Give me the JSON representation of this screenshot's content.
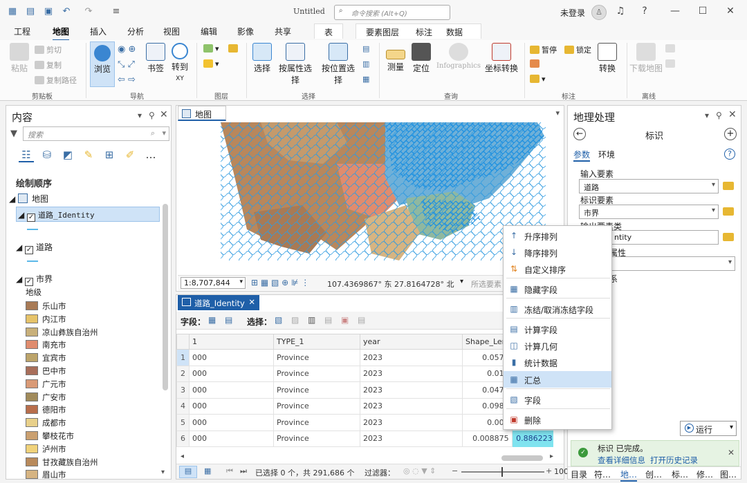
{
  "window": {
    "title": "Untitled",
    "search_placeholder": "命令搜索 (Alt+Q)",
    "login": "未登录",
    "help": "?"
  },
  "tabs": [
    "工程",
    "地图",
    "插入",
    "分析",
    "视图",
    "编辑",
    "影像",
    "共享"
  ],
  "active_tab": "地图",
  "context_tabs": [
    "表",
    "要素图层",
    "标注",
    "数据"
  ],
  "ribbon": {
    "clipboard": {
      "paste": "粘贴",
      "cut": "剪切",
      "copy": "复制",
      "copy_path": "复制路径",
      "label": "剪贴板"
    },
    "navigate": {
      "explore": "浏览",
      "bookmarks": "书签",
      "goto": "转到",
      "goto_sub": "XY",
      "label": "导航"
    },
    "layer": {
      "label": "图层"
    },
    "selection": {
      "select": "选择",
      "by_attr": "按属性选择",
      "by_loc": "按位置选择",
      "label": "选择"
    },
    "inquiry": {
      "measure": "测量",
      "locate": "定位",
      "infographics": "Infographics",
      "convert_coords": "坐标转换",
      "label": "查询"
    },
    "labeling": {
      "pause": "暂停",
      "lock": "锁定",
      "convert": "转换",
      "label": "标注"
    },
    "offline": {
      "download": "下载地图",
      "label": "离线"
    }
  },
  "contents": {
    "title": "内容",
    "search_placeholder": "搜索",
    "drawing_order": "绘制顺序",
    "map_node": "地图",
    "layers": [
      {
        "name": "道路_Identity",
        "checked": true,
        "selected": true
      },
      {
        "name": "道路",
        "checked": true
      },
      {
        "name": "市界",
        "checked": true
      }
    ],
    "legend_field": "地级",
    "legend": [
      {
        "name": "乐山市",
        "color": "#a87a55"
      },
      {
        "name": "内江市",
        "color": "#e6c36a"
      },
      {
        "name": "凉山彝族自治州",
        "color": "#c8b07a"
      },
      {
        "name": "南充市",
        "color": "#e08c6e"
      },
      {
        "name": "宜宾市",
        "color": "#bca46a"
      },
      {
        "name": "巴中市",
        "color": "#a86e5a"
      },
      {
        "name": "广元市",
        "color": "#d99a76"
      },
      {
        "name": "广安市",
        "color": "#a08a5a"
      },
      {
        "name": "德阳市",
        "color": "#b86e4c"
      },
      {
        "name": "成都市",
        "color": "#e8d08a"
      },
      {
        "name": "攀枝花市",
        "color": "#caa070"
      },
      {
        "name": "泸州市",
        "color": "#f0d27a"
      },
      {
        "name": "甘孜藏族自治州",
        "color": "#b88a5c"
      },
      {
        "name": "眉山市",
        "color": "#d6b482"
      }
    ]
  },
  "map": {
    "tab": "地图",
    "scale": "1:8,707,844",
    "coords": "107.4369867° 东  27.8164728° 北",
    "selected_features": "所选要素"
  },
  "attribute_table": {
    "tab": "道路_Identity",
    "field_label": "字段：",
    "select_label": "选择：",
    "columns": [
      "1",
      "TYPE_1",
      "year",
      "Shape_Leng"
    ],
    "rows": [
      {
        "n": "1",
        "c1": "000",
        "type": "Province",
        "year": "2023",
        "shape": "0.0577"
      },
      {
        "n": "2",
        "c1": "000",
        "type": "Province",
        "year": "2023",
        "shape": "0.012"
      },
      {
        "n": "3",
        "c1": "000",
        "type": "Province",
        "year": "2023",
        "shape": "0.0479"
      },
      {
        "n": "4",
        "c1": "000",
        "type": "Province",
        "year": "2023",
        "shape": "0.0982"
      },
      {
        "n": "5",
        "c1": "000",
        "type": "Province",
        "year": "2023",
        "shape": "0.005"
      },
      {
        "n": "6",
        "c1": "000",
        "type": "Province",
        "year": "2023",
        "shape": "0.008875",
        "extra": "0.886223"
      }
    ],
    "status": "已选择 0 个，共 291,686 个",
    "filter_label": "过滤器：",
    "zoom": "100"
  },
  "context_menu": [
    {
      "label": "升序排列",
      "icon": "sort-ascending-icon"
    },
    {
      "label": "降序排列",
      "icon": "sort-descending-icon"
    },
    {
      "label": "自定义排序",
      "icon": "custom-sort-icon"
    },
    {
      "label": "隐藏字段",
      "icon": "hide-field-icon"
    },
    {
      "label": "冻结/取消冻结字段",
      "icon": "freeze-field-icon"
    },
    {
      "label": "计算字段",
      "icon": "calculate-field-icon"
    },
    {
      "label": "计算几何",
      "icon": "calculate-geometry-icon"
    },
    {
      "label": "统计数据",
      "icon": "statistics-icon"
    },
    {
      "label": "汇总",
      "icon": "summarize-icon",
      "highlighted": true
    },
    {
      "label": "字段",
      "icon": "fields-icon"
    },
    {
      "label": "删除",
      "icon": "delete-icon"
    }
  ],
  "geoprocessing": {
    "title": "地理处理",
    "tool": "标识",
    "tab_params": "参数",
    "tab_env": "环境",
    "input_label": "输入要素",
    "input_value": "道路",
    "identity_label": "标识要素",
    "identity_value": "市界",
    "output_label": "输出要素类",
    "output_value": "ntity",
    "attr_label": "属性",
    "rel_label": "系",
    "run": "运行",
    "status_title": "标识 已完成。",
    "link_details": "查看详细信息",
    "link_history": "打开历史记录",
    "bottom_tabs": [
      "目录",
      "符…",
      "地…",
      "创…",
      "标…",
      "修…",
      "图…"
    ]
  }
}
